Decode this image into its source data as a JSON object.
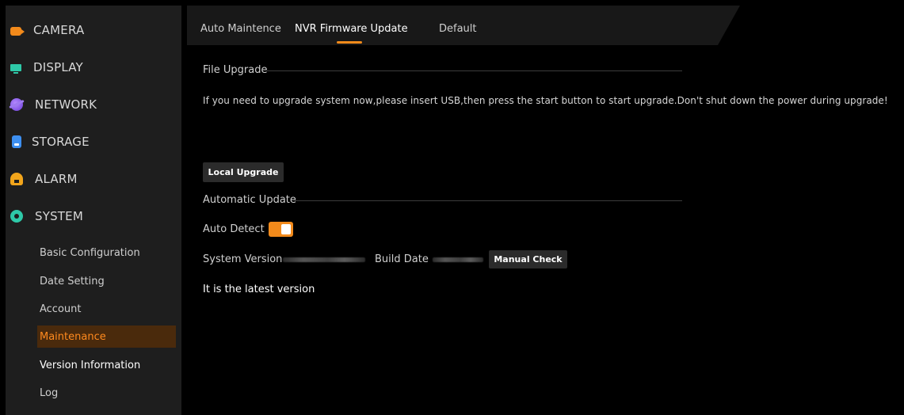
{
  "sidebar": {
    "menu": [
      {
        "label": "CAMERA",
        "icon": "camera-icon"
      },
      {
        "label": "DISPLAY",
        "icon": "display-icon"
      },
      {
        "label": "NETWORK",
        "icon": "network-icon"
      },
      {
        "label": "STORAGE",
        "icon": "storage-icon"
      },
      {
        "label": "ALARM",
        "icon": "alarm-icon"
      },
      {
        "label": "SYSTEM",
        "icon": "system-icon"
      }
    ],
    "system_submenu": [
      {
        "label": "Basic Configuration"
      },
      {
        "label": "Date Setting"
      },
      {
        "label": "Account"
      },
      {
        "label": "Maintenance",
        "active": true
      },
      {
        "label": "Version Information"
      },
      {
        "label": "Log"
      }
    ]
  },
  "tabs": [
    {
      "label": "Auto Maintence"
    },
    {
      "label": "NVR Firmware Update",
      "active": true
    },
    {
      "label": "Default"
    }
  ],
  "file_upgrade": {
    "title": "File Upgrade",
    "description": "If you need to upgrade system now,please insert USB,then press the start button to start upgrade.Don't shut down the power during upgrade!",
    "button": "Local Upgrade"
  },
  "automatic_update": {
    "title": "Automatic Update",
    "auto_detect_label": "Auto Detect",
    "auto_detect_on": true,
    "system_version_label": "System Version",
    "build_date_label": "Build Date",
    "check_button": "Manual Check",
    "status": "It is the latest version"
  },
  "colors": {
    "accent": "#f28a1b",
    "sidebar_bg": "#1e1e1e",
    "active_bg": "#4a2a0c"
  }
}
